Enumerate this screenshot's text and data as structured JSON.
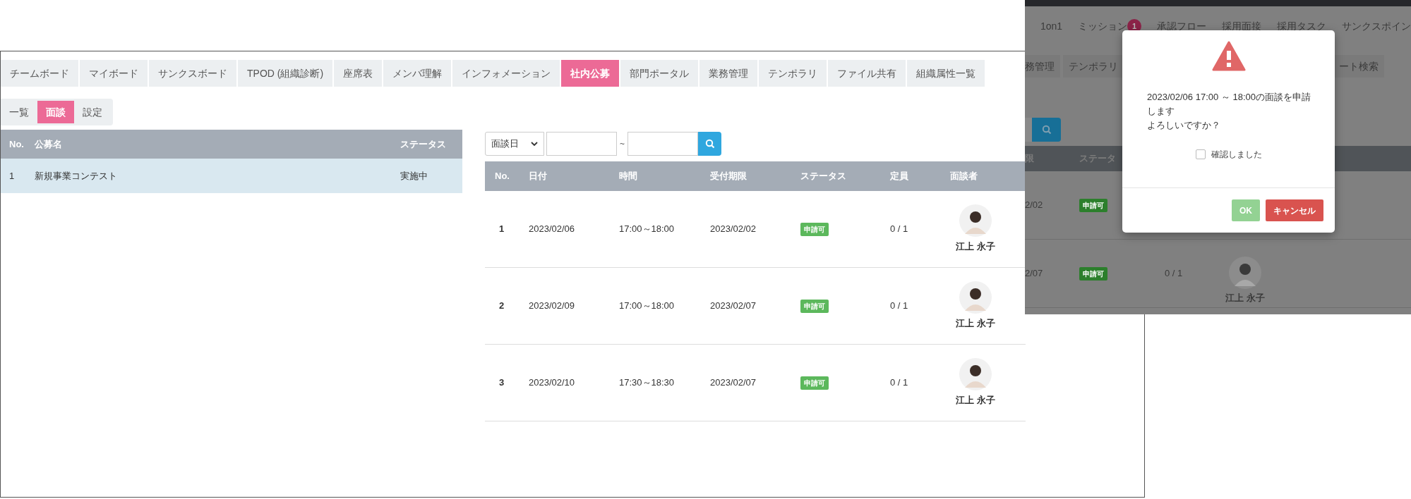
{
  "main_window": {
    "tabs": [
      {
        "label": "チームボード",
        "selected": false
      },
      {
        "label": "マイボード",
        "selected": false
      },
      {
        "label": "サンクスボード",
        "selected": false
      },
      {
        "label": "TPOD (組織診断)",
        "selected": false
      },
      {
        "label": "座席表",
        "selected": false
      },
      {
        "label": "メンバ理解",
        "selected": false
      },
      {
        "label": "インフォメーション",
        "selected": false
      },
      {
        "label": "社内公募",
        "selected": true
      },
      {
        "label": "部門ポータル",
        "selected": false
      },
      {
        "label": "業務管理",
        "selected": false
      },
      {
        "label": "テンポラリ",
        "selected": false
      },
      {
        "label": "ファイル共有",
        "selected": false
      },
      {
        "label": "組織属性一覧",
        "selected": false
      }
    ],
    "subtabs": [
      {
        "label": "一覧",
        "selected": false
      },
      {
        "label": "面談",
        "selected": true
      },
      {
        "label": "設定",
        "selected": false
      }
    ],
    "recruitment_table": {
      "columns": [
        "No.",
        "公募名",
        "ステータス"
      ],
      "rows": [
        {
          "no": "1",
          "name": "新規事業コンテスト",
          "status": "実施中",
          "selected": true
        }
      ]
    },
    "filter": {
      "field": "面談日",
      "separator": "~"
    },
    "interview_table": {
      "columns": [
        "No.",
        "日付",
        "時間",
        "受付期限",
        "ステータス",
        "定員",
        "面談者"
      ],
      "rows": [
        {
          "no": "1",
          "date": "2023/02/06",
          "time": "17:00～18:00",
          "deadline": "2023/02/02",
          "status": "申請可",
          "capacity": "0 / 1",
          "interviewer": "江上 永子"
        },
        {
          "no": "2",
          "date": "2023/02/09",
          "time": "17:00～18:00",
          "deadline": "2023/02/07",
          "status": "申請可",
          "capacity": "0 / 1",
          "interviewer": "江上 永子"
        },
        {
          "no": "3",
          "date": "2023/02/10",
          "time": "17:30～18:30",
          "deadline": "2023/02/07",
          "status": "申請可",
          "capacity": "0 / 1",
          "interviewer": "江上 永子"
        }
      ]
    }
  },
  "background_screen": {
    "tabs": [
      {
        "label": "1on1"
      },
      {
        "label": "ミッション",
        "badge": "1"
      },
      {
        "label": "承認フロー"
      },
      {
        "label": "採用面接"
      },
      {
        "label": "採用タスク"
      },
      {
        "label": "サンクスポイン"
      }
    ],
    "subtabs": [
      "務管理",
      "テンポラリ",
      "ート検索"
    ],
    "columns": [
      "限",
      "ステータ"
    ],
    "rows": [
      {
        "deadline": "2/02",
        "status": "申請可"
      },
      {
        "deadline": "2/07",
        "status": "申請可",
        "capacity": "0 / 1",
        "interviewer": "江上 永子"
      }
    ]
  },
  "dialog": {
    "message": [
      "2023/02/06 17:00 ～ 18:00の面談を申請します",
      "よろしいですか？"
    ],
    "checkbox": {
      "label": "確認しました",
      "checked": false
    },
    "buttons": [
      {
        "kind": "ok",
        "label": "OK",
        "disabled": true
      },
      {
        "kind": "cancel",
        "label": "キャンセル",
        "disabled": false
      }
    ]
  }
}
